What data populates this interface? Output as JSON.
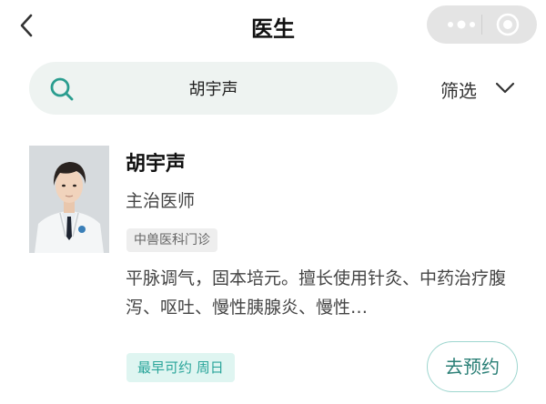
{
  "header": {
    "title": "医生"
  },
  "search": {
    "query": "胡宇声"
  },
  "filter": {
    "label": "筛选"
  },
  "doctor": {
    "name": "胡宇声",
    "title": "主治医师",
    "department": "中兽医科门诊",
    "description": "平脉调气，固本培元。擅长使用针灸、中药治疗腹泻、呕吐、慢性胰腺炎、慢性…",
    "availability": "最早可约 周日",
    "book_label": "去预约"
  },
  "colors": {
    "accent": "#2aa59a",
    "search_bg": "#eef3f1",
    "tag_bg": "#dff5f1"
  },
  "icons": [
    "back-arrow-icon",
    "more-dots-icon",
    "close-target-icon",
    "search-icon",
    "chevron-down-icon"
  ]
}
